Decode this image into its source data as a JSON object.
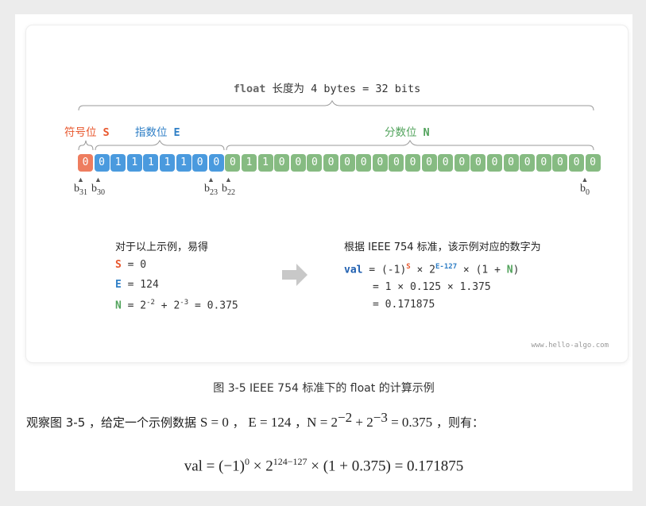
{
  "figure": {
    "title_keyword": "float",
    "title_rest": " 长度为 4 bytes = 32 bits",
    "labels": {
      "sign": {
        "text": "符号位",
        "symbol": "S"
      },
      "exponent": {
        "text": "指数位",
        "symbol": "E"
      },
      "fraction": {
        "text": "分数位",
        "symbol": "N"
      }
    },
    "bits": {
      "sign": [
        "0"
      ],
      "exponent": [
        "0",
        "1",
        "1",
        "1",
        "1",
        "1",
        "0",
        "0"
      ],
      "fraction": [
        "0",
        "1",
        "1",
        "0",
        "0",
        "0",
        "0",
        "0",
        "0",
        "0",
        "0",
        "0",
        "0",
        "0",
        "0",
        "0",
        "0",
        "0",
        "0",
        "0",
        "0",
        "0",
        "0"
      ]
    },
    "bit_labels": {
      "b31": {
        "base": "b",
        "sub": "31"
      },
      "b30": {
        "base": "b",
        "sub": "30"
      },
      "b23": {
        "base": "b",
        "sub": "23"
      },
      "b22": {
        "base": "b",
        "sub": "22"
      },
      "b0": {
        "base": "b",
        "sub": "0"
      }
    },
    "left_panel": {
      "heading": "对于以上示例，易得",
      "s_key": "S",
      "s_value": " = 0",
      "e_key": "E",
      "e_value": " = 124",
      "n_key": "N",
      "n_eq": " = 2",
      "n_exp1": "-2",
      "n_plus": " + 2",
      "n_exp2": "-3",
      "n_result": " = 0.375"
    },
    "right_panel": {
      "heading": "根据 IEEE 754 标准，该示例对应的数字为",
      "line1": {
        "val": "val",
        "a": " = (-1)",
        "sup_s": "S",
        "b": " × 2",
        "sup_e": "E-127",
        "c": " × (1 + ",
        "n": "N",
        "d": ")"
      },
      "line2": "= 1 × 0.125 × 1.375",
      "line3": "= 0.171875"
    },
    "watermark": "www.hello-algo.com"
  },
  "caption": "图 3-5   IEEE 754 标准下的 float 的计算示例",
  "paragraph": {
    "prefix": "观察图 3-5 ，给定一个示例数据 ",
    "s": "S = 0",
    "sep1": " ，  ",
    "e": "E = 124",
    "sep2": " ，",
    "n1": "N = 2",
    "exp1": "−2",
    "n2": " + 2",
    "exp2": "−3",
    "n3": " = 0.375",
    "suffix": " ，则有："
  },
  "formula": {
    "a": "val  = (−1)",
    "exp0": "0",
    "b": " × 2",
    "exp1": "124−127",
    "c": " × (1 + 0.375) = 0.171875"
  },
  "colors": {
    "sign": "#ee7d5f",
    "exponent": "#4a9ade",
    "fraction": "#86bb82"
  }
}
